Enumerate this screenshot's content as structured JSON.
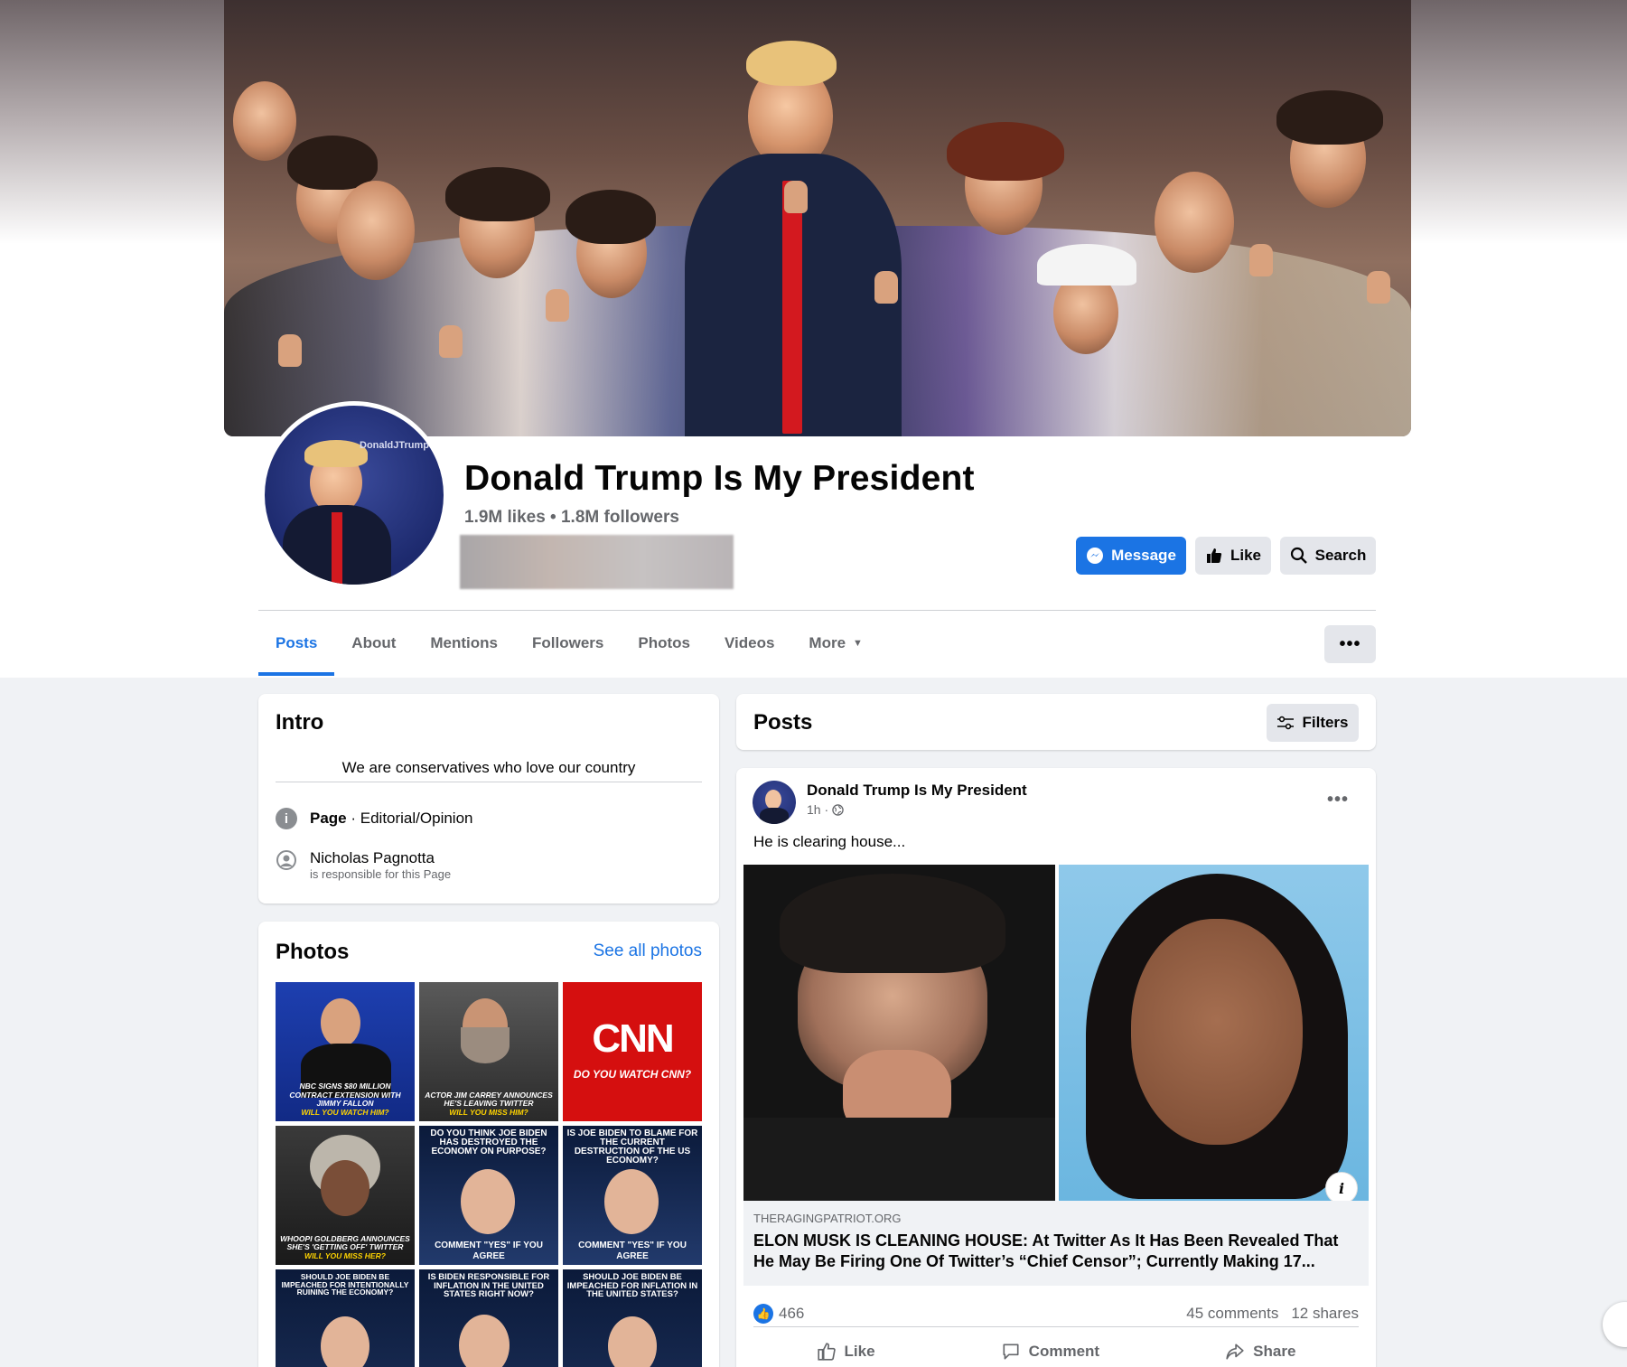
{
  "page": {
    "name": "Donald Trump Is My President",
    "stats": "1.9M likes • 1.8M followers"
  },
  "actions": {
    "message": "Message",
    "like": "Like",
    "search": "Search"
  },
  "tabs": [
    {
      "label": "Posts",
      "active": true
    },
    {
      "label": "About"
    },
    {
      "label": "Mentions"
    },
    {
      "label": "Followers"
    },
    {
      "label": "Photos"
    },
    {
      "label": "Videos"
    },
    {
      "label": "More"
    }
  ],
  "intro": {
    "title": "Intro",
    "bio": "We are conservatives who love our country",
    "category_label": "Page",
    "category_value": " · Editorial/Opinion",
    "responsible_name": "Nicholas Pagnotta",
    "responsible_note": "is responsible for this Page"
  },
  "photos": {
    "title": "Photos",
    "see_all": "See all photos",
    "items": [
      {
        "top": "",
        "caption": "NBC signs $80 million contract extension with Jimmy Fallon",
        "caption2": "Will you watch him?"
      },
      {
        "top": "",
        "caption": "Actor Jim Carrey announces he's leaving Twitter",
        "caption2": "Will you miss him?"
      },
      {
        "top": "CNN",
        "caption": "Do you watch CNN?",
        "caption2": ""
      },
      {
        "top": "",
        "caption": "Whoopi Goldberg announces she's 'getting off' Twitter",
        "caption2": "Will you miss her?"
      },
      {
        "top": "Do you think Joe Biden has destroyed the economy on purpose?",
        "caption": "Comment \"YES\" if you agree",
        "caption2": ""
      },
      {
        "top": "Is Joe Biden to blame for the current destruction of the US economy?",
        "caption": "Comment \"YES\" if you agree",
        "caption2": ""
      },
      {
        "top": "Should Joe Biden be impeached for intentionally ruining the economy?",
        "caption": "",
        "caption2": ""
      },
      {
        "top": "Is Biden responsible for inflation in the United States right now?",
        "caption": "",
        "caption2": ""
      },
      {
        "top": "Should Joe Biden be impeached for inflation in the United States?",
        "caption": "",
        "caption2": ""
      }
    ]
  },
  "posts": {
    "title": "Posts",
    "filters": "Filters"
  },
  "post": {
    "author": "Donald Trump Is My President",
    "time": "1h ·",
    "text": "He is clearing house...",
    "link_domain": "THERAGINGPATRIOT.ORG",
    "link_title": "ELON MUSK IS CLEANING HOUSE: At Twitter As It Has Been Revealed That He May Be Firing One Of Twitter’s “Chief Censor”; Currently Making 17...",
    "reactions": "466",
    "comments": "45 comments",
    "shares": "12 shares",
    "like_label": "Like",
    "comment_label": "Comment",
    "share_label": "Share"
  },
  "colors": {
    "accent": "#1b74e4",
    "background": "#f0f2f5",
    "secondary_text": "#65676b"
  }
}
